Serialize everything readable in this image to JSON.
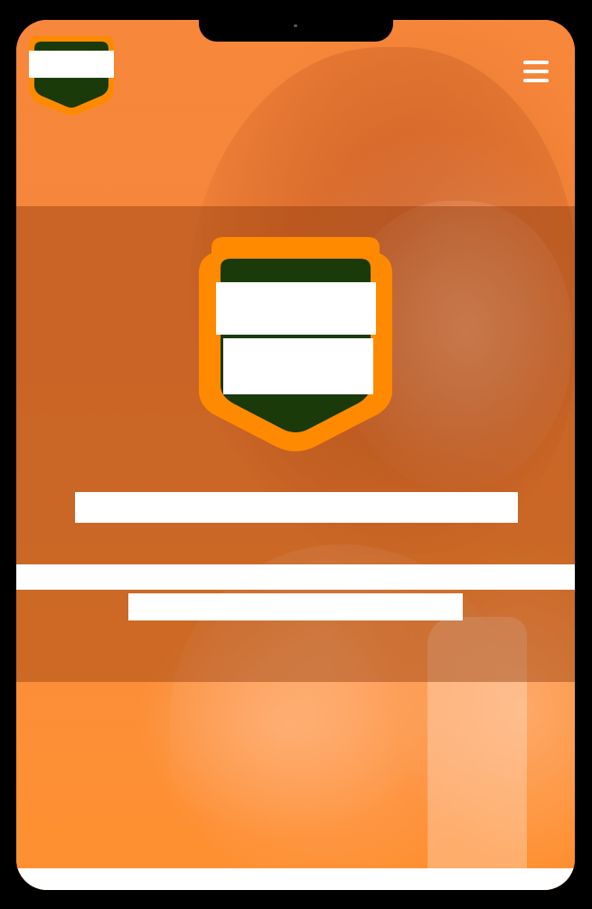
{
  "header": {
    "logo_icon": "shield-logo-icon",
    "menu_icon": "hamburger-menu-icon"
  },
  "hero": {
    "logo_icon": "shield-logo-icon",
    "title": "",
    "subtitle": ""
  },
  "colors": {
    "brand_orange": "#ff8a00",
    "brand_green": "#1a3a0a",
    "overlay": "#8c370a"
  }
}
